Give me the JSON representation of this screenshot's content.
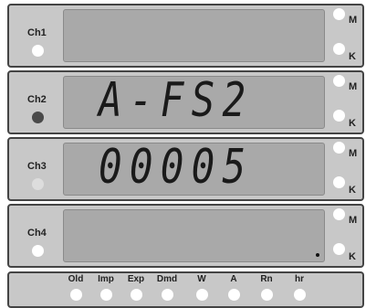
{
  "channels": [
    {
      "label": "Ch1",
      "led_state": "off",
      "led_color": "#ffffff",
      "display": "",
      "decimal_point": false,
      "unit_m": "M",
      "unit_k": "K"
    },
    {
      "label": "Ch2",
      "led_state": "on",
      "led_color": "#4a4a4a",
      "display": "A-FS2",
      "decimal_point": false,
      "unit_m": "M",
      "unit_k": "K"
    },
    {
      "label": "Ch3",
      "led_state": "dim",
      "led_color": "#dddddd",
      "display": "00005",
      "decimal_point": false,
      "unit_m": "M",
      "unit_k": "K"
    },
    {
      "label": "Ch4",
      "led_state": "off",
      "led_color": "#ffffff",
      "display": "",
      "decimal_point": true,
      "unit_m": "M",
      "unit_k": "K"
    }
  ],
  "indicators": [
    {
      "label": "Old"
    },
    {
      "label": "Imp"
    },
    {
      "label": "Exp"
    },
    {
      "label": "Dmd"
    },
    {
      "label": "W"
    },
    {
      "label": "A"
    },
    {
      "label": "Rn"
    },
    {
      "label": "hr"
    }
  ],
  "colors": {
    "panel": "#c8c8c8",
    "display_bg": "#a9a9a9",
    "segment": "#1a1a1a",
    "led_off": "#ffffff",
    "border": "#444444"
  }
}
